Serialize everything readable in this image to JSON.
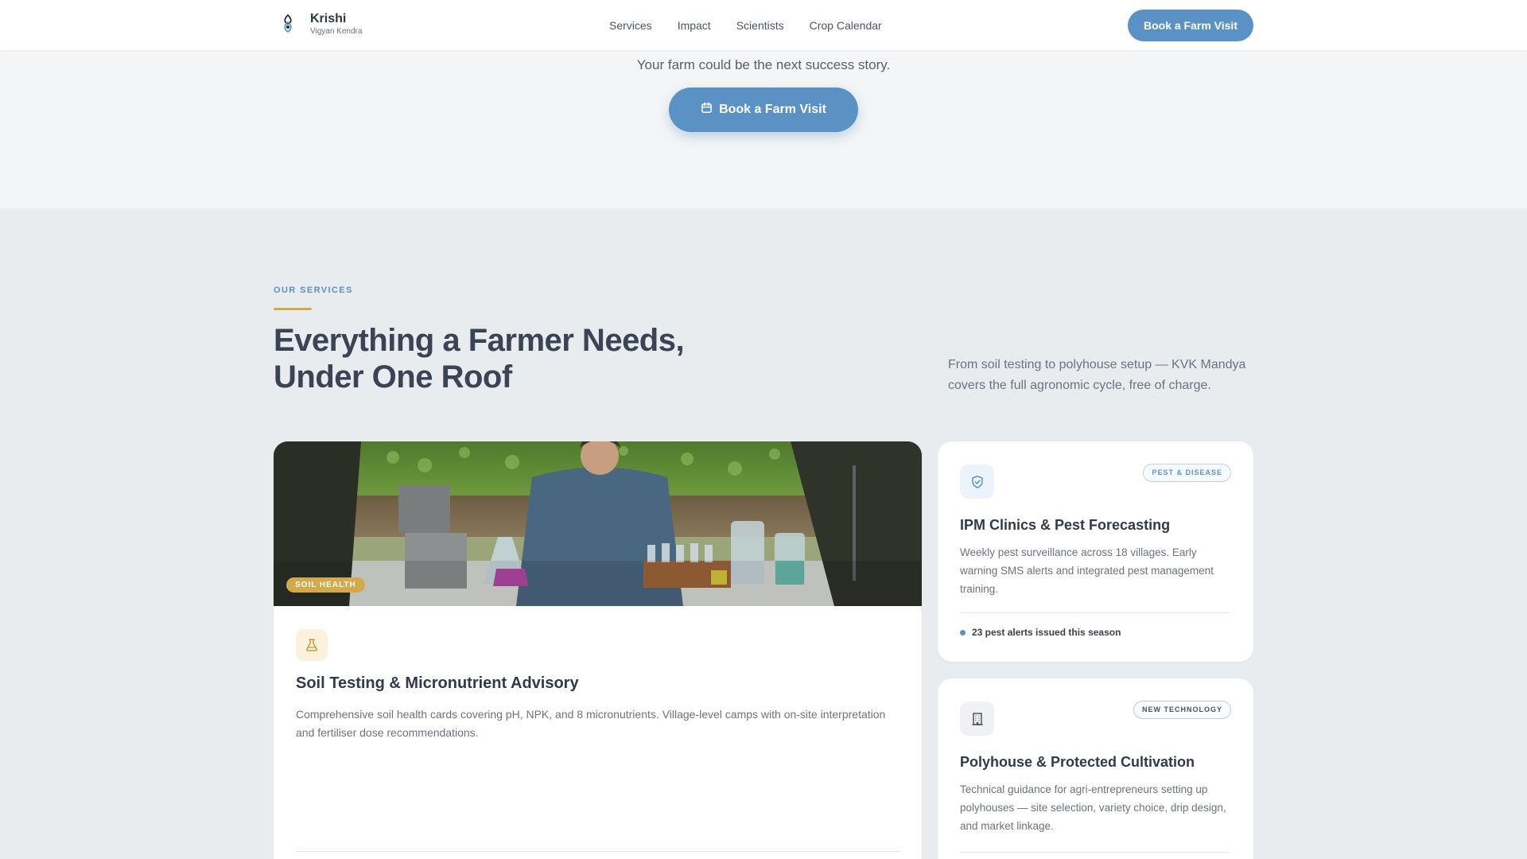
{
  "header": {
    "brand_name": "Krishi",
    "brand_sub": "Vigyan Kendra",
    "nav": [
      "Services",
      "Impact",
      "Scientists",
      "Crop Calendar"
    ],
    "cta_label": "Book a Farm Visit"
  },
  "hero": {
    "subtitle": "Your farm could be the next success story.",
    "cta_label": "Book a Farm Visit"
  },
  "services": {
    "eyebrow": "OUR SERVICES",
    "title_line1": "Everything a Farmer Needs,",
    "title_line2": "Under One Roof",
    "description": "From soil testing to polyhouse setup — KVK Mandya covers the full agronomic cycle, free of charge.",
    "cards": [
      {
        "tag": "SOIL HEALTH",
        "icon": "flask-icon",
        "title": "Soil Testing & Micronutrient Advisory",
        "description": "Comprehensive soil health cards covering pH, NPK, and 8 micronutrients. Village-level camps with on-site interpretation and fertiliser dose recommendations."
      },
      {
        "tag": "PEST & DISEASE",
        "icon": "shield-check-icon",
        "title": "IPM Clinics & Pest Forecasting",
        "description": "Weekly pest surveillance across 18 villages. Early warning SMS alerts and integrated pest management training.",
        "stat": "23 pest alerts issued this season"
      },
      {
        "tag": "NEW TECHNOLOGY",
        "icon": "building-icon",
        "title": "Polyhouse & Protected Cultivation",
        "description": "Technical guidance for agri-entrepreneurs setting up polyhouses — site selection, variety choice, drip design, and market linkage."
      }
    ]
  },
  "colors": {
    "accent": "#5a92c6",
    "gold": "#d4a94b",
    "heading": "#3a4455",
    "page_bg": "#e9ecef"
  }
}
